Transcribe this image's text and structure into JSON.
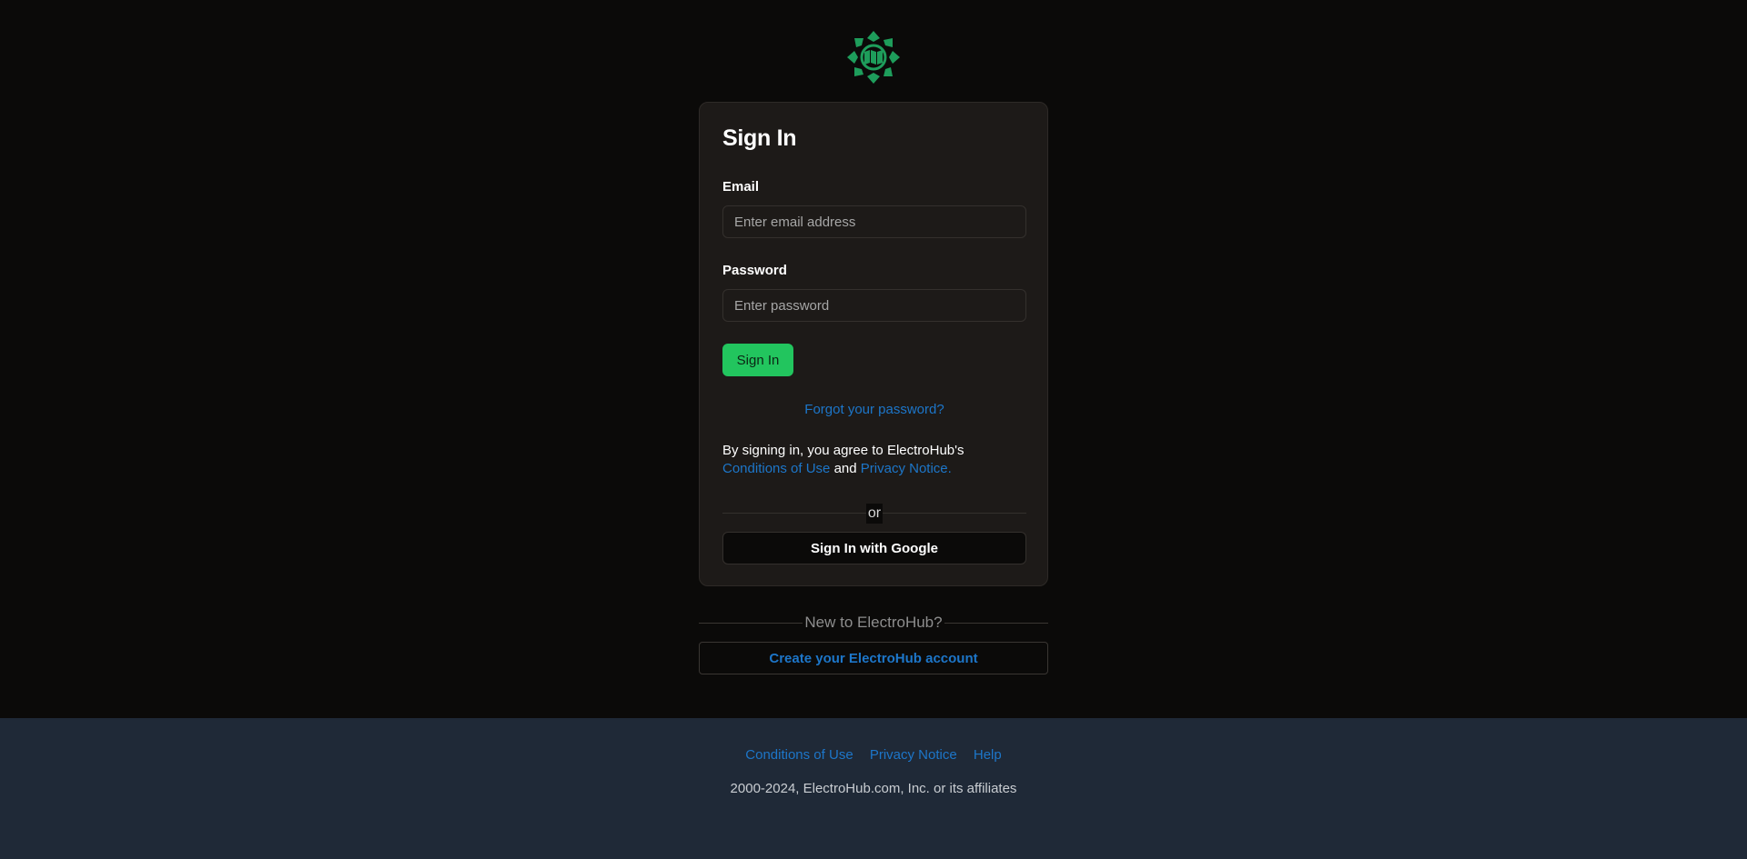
{
  "brand": {
    "name": "ElectroHub",
    "logo_icon": "green-pinwheel-map-logo-icon",
    "accent_color": "#22c55e",
    "link_color": "#1d76c9"
  },
  "signin": {
    "title": "Sign In",
    "email_label": "Email",
    "email_placeholder": "Enter email address",
    "password_label": "Password",
    "password_placeholder": "Enter password",
    "submit_label": "Sign In",
    "forgot_password": "Forgot your password?",
    "agree_prefix": "By signing in, you agree to ElectroHub's",
    "conditions_link": "Conditions of Use",
    "agree_and": "and",
    "privacy_link": "Privacy Notice.",
    "or_text": "or",
    "google_button": "Sign In with Google"
  },
  "register": {
    "prompt": "New to ElectroHub?",
    "create_button": "Create your ElectroHub account"
  },
  "footer": {
    "links": [
      "Conditions of Use",
      "Privacy Notice",
      "Help"
    ],
    "copyright": "2000-2024, ElectroHub.com, Inc. or its affiliates"
  }
}
